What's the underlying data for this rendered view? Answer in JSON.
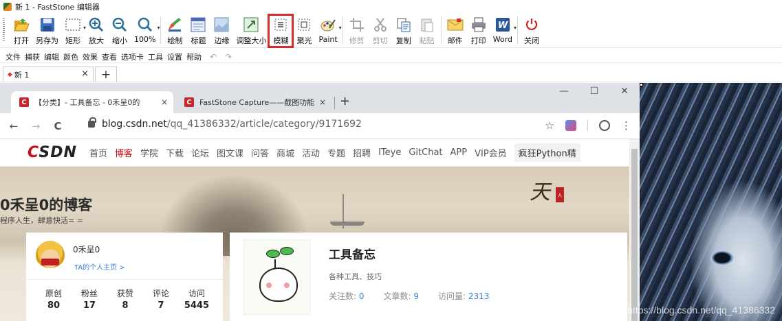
{
  "app": {
    "title": "新 1 - FastStone 编辑器"
  },
  "toolbar": {
    "buttons": [
      {
        "label": "打开",
        "icon": "folder-open-icon"
      },
      {
        "label": "另存为",
        "icon": "save-disk-icon"
      },
      {
        "label": "矩形",
        "icon": "rect-select-icon"
      },
      {
        "label": "放大",
        "icon": "zoom-in-icon"
      },
      {
        "label": "缩小",
        "icon": "zoom-out-icon"
      },
      {
        "label": "100%",
        "icon": "zoom-100-icon"
      },
      {
        "label": "绘制",
        "icon": "draw-icon"
      },
      {
        "label": "标题",
        "icon": "caption-icon"
      },
      {
        "label": "边缘",
        "icon": "edge-icon"
      },
      {
        "label": "调整大小",
        "icon": "resize-icon"
      },
      {
        "label": "模糊",
        "icon": "blur-icon",
        "selected": true
      },
      {
        "label": "聚光",
        "icon": "spotlight-icon"
      },
      {
        "label": "Paint",
        "icon": "paint-icon"
      },
      {
        "label": "修剪",
        "icon": "crop-icon",
        "disabled": true
      },
      {
        "label": "剪切",
        "icon": "cut-icon",
        "disabled": true
      },
      {
        "label": "复制",
        "icon": "copy-icon"
      },
      {
        "label": "粘贴",
        "icon": "paste-icon",
        "disabled": true
      },
      {
        "label": "邮件",
        "icon": "email-icon"
      },
      {
        "label": "打印",
        "icon": "print-icon"
      },
      {
        "label": "Word",
        "icon": "word-icon"
      },
      {
        "label": "关闭",
        "icon": "power-icon"
      }
    ]
  },
  "menu": {
    "items": [
      "文件",
      "捕获",
      "编辑",
      "颜色",
      "效果",
      "查看",
      "选项卡",
      "工具",
      "设置",
      "帮助"
    ]
  },
  "doc_tabs": {
    "active": {
      "label": "新 1"
    },
    "add_label": "+",
    "close_label": "×"
  },
  "browser": {
    "tabs": [
      {
        "fav": "C",
        "label": "【分类】- 工具备忘 - 0禾呈0的",
        "close": "×"
      },
      {
        "fav": "C",
        "label": "FastStone Capture——截图功能",
        "close": "×"
      }
    ],
    "new_tab": "+",
    "window_buttons": [
      "—",
      "☐",
      "✕"
    ],
    "nav": {
      "back": "←",
      "forward": "→",
      "reload": "C"
    },
    "url_host": "blog.csdn.net",
    "url_path": "/qq_41386332/article/category/9171692",
    "star": "☆",
    "more": "⋮"
  },
  "csdn": {
    "logo_c": "C",
    "logo_rest": "SDN",
    "nav": [
      "首页",
      "博客",
      "学院",
      "下载",
      "论坛",
      "图文课",
      "问答",
      "商城",
      "活动",
      "专题",
      "招聘",
      "ITeye",
      "GitChat",
      "APP",
      "VIP会员",
      "疯狂Python精"
    ],
    "active_nav": "博客",
    "blog_title": "0禾呈0的博客",
    "blog_subtitle": "程序人生，肆意快活= =",
    "calligraphy": "天",
    "seal_text": "人",
    "profile": {
      "name": "0禾呈0",
      "home_link": "TA的个人主页 >",
      "stats": [
        {
          "label": "原创",
          "value": "80"
        },
        {
          "label": "粉丝",
          "value": "17"
        },
        {
          "label": "获赞",
          "value": "8"
        },
        {
          "label": "评论",
          "value": "7"
        },
        {
          "label": "访问",
          "value": "5445"
        }
      ]
    },
    "category": {
      "title": "工具备忘",
      "desc": "各种工具、技巧",
      "followers_label": "关注数:",
      "followers": "0",
      "articles_label": "文章数:",
      "articles": "9",
      "views_label": "访问量:",
      "views": "2313"
    }
  },
  "watermark": "https://blog.csdn.net/qq_41386332"
}
